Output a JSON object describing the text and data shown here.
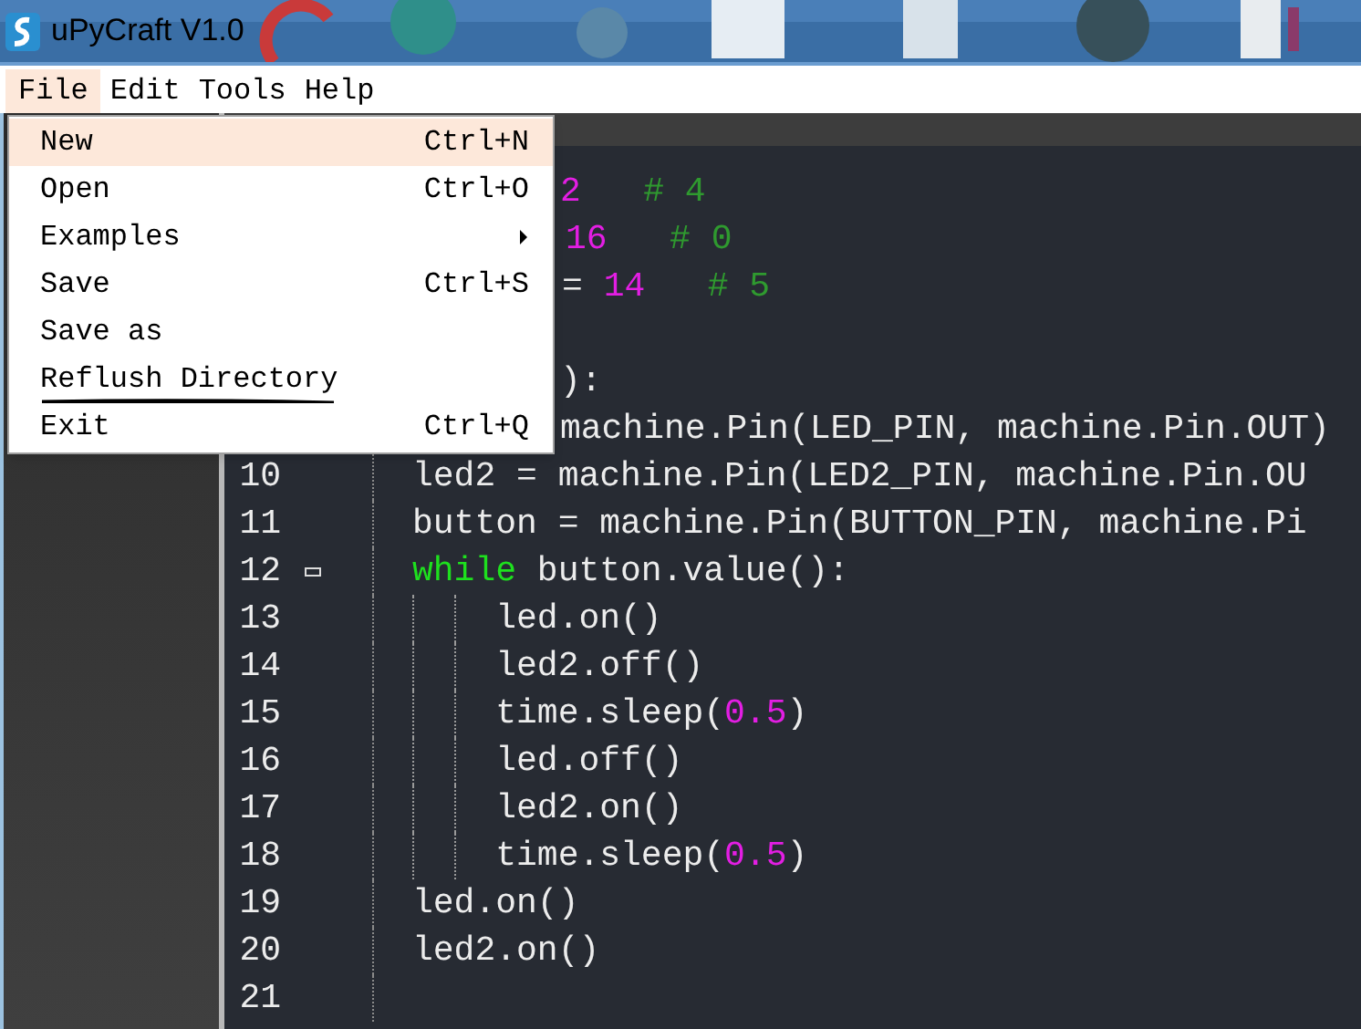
{
  "window": {
    "title": "uPyCraft V1.0"
  },
  "menu_bar": [
    {
      "label": "File",
      "selected": true
    },
    {
      "label": "Edit",
      "selected": false
    },
    {
      "label": "Tools",
      "selected": false
    },
    {
      "label": "Help",
      "selected": false
    }
  ],
  "file_menu": {
    "items": [
      {
        "label": "New",
        "shortcut": "Ctrl+N",
        "selected": true,
        "submenu": false
      },
      {
        "label": "Open",
        "shortcut": "Ctrl+O",
        "selected": false,
        "submenu": false
      },
      {
        "label": "Examples",
        "selected": false,
        "submenu": true
      },
      {
        "label": "Save",
        "shortcut": "Ctrl+S",
        "selected": false,
        "submenu": false
      },
      {
        "label": "Save as",
        "selected": false,
        "submenu": false
      },
      {
        "label": "Reflush Directory",
        "selected": false,
        "submenu": false,
        "underlined_by_hand": true
      },
      {
        "label": "Exit",
        "shortcut": "Ctrl+Q",
        "selected": false,
        "submenu": false
      }
    ]
  },
  "editor": {
    "partial_lines": [
      {
        "tokens": [
          {
            "kind": "number",
            "text": "2"
          },
          {
            "kind": "comment",
            "text": "   # 4"
          }
        ]
      },
      {
        "tokens": [
          {
            "kind": "number",
            "text": "16"
          },
          {
            "kind": "comment",
            "text": "   # 0"
          }
        ]
      },
      {
        "tokens": [
          {
            "kind": "plain",
            "text": "= "
          },
          {
            "kind": "number",
            "text": "14"
          },
          {
            "kind": "comment",
            "text": "   # 5"
          }
        ]
      },
      {
        "tokens": [
          {
            "kind": "plain",
            "text": "):"
          }
        ]
      },
      {
        "tokens": [
          {
            "kind": "plain",
            "text": "machine.Pin(LED_PIN, machine.Pin.OUT)"
          }
        ]
      }
    ],
    "lines": [
      {
        "number": "10",
        "tokens": [
          {
            "kind": "plain",
            "text": "led2 = machine.Pin(LED2_PIN, machine.Pin.OU"
          }
        ]
      },
      {
        "number": "11",
        "tokens": [
          {
            "kind": "plain",
            "text": "button = machine.Pin(BUTTON_PIN, machine.Pi"
          }
        ]
      },
      {
        "number": "12",
        "fold_expanded": true,
        "tokens": [
          {
            "kind": "keyword",
            "text": "while"
          },
          {
            "kind": "plain",
            "text": " button.value():"
          }
        ]
      },
      {
        "number": "13",
        "tokens": [
          {
            "kind": "plain",
            "text": "    led.on()"
          }
        ]
      },
      {
        "number": "14",
        "tokens": [
          {
            "kind": "plain",
            "text": "    led2.off()"
          }
        ]
      },
      {
        "number": "15",
        "tokens": [
          {
            "kind": "plain",
            "text": "    time.sleep("
          },
          {
            "kind": "number",
            "text": "0.5"
          },
          {
            "kind": "plain",
            "text": ")"
          }
        ]
      },
      {
        "number": "16",
        "tokens": [
          {
            "kind": "plain",
            "text": "    led.off()"
          }
        ]
      },
      {
        "number": "17",
        "tokens": [
          {
            "kind": "plain",
            "text": "    led2.on()"
          }
        ]
      },
      {
        "number": "18",
        "tokens": [
          {
            "kind": "plain",
            "text": "    time.sleep("
          },
          {
            "kind": "number",
            "text": "0.5"
          },
          {
            "kind": "plain",
            "text": ")"
          }
        ]
      },
      {
        "number": "19",
        "tokens": [
          {
            "kind": "plain",
            "text": "led.on()"
          }
        ]
      },
      {
        "number": "20",
        "tokens": [
          {
            "kind": "plain",
            "text": "led2.on()"
          }
        ]
      },
      {
        "number": "21"
      }
    ]
  }
}
